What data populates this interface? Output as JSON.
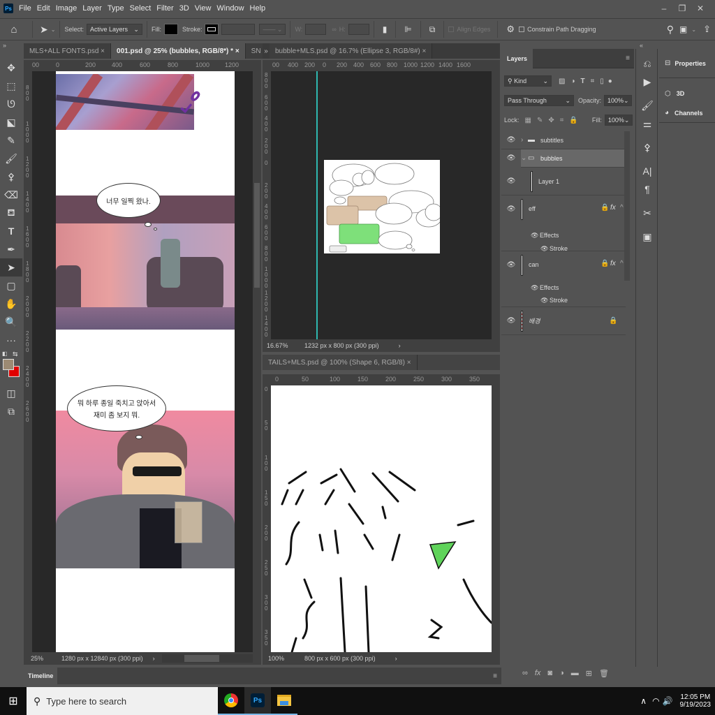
{
  "app": {
    "logo": "Ps",
    "menu": [
      "File",
      "Edit",
      "Image",
      "Layer",
      "Type",
      "Select",
      "Filter",
      "3D",
      "View",
      "Window",
      "Help"
    ]
  },
  "window_controls": {
    "minimize": "‒",
    "restore": "❐",
    "close": "✕"
  },
  "options_bar": {
    "select_label": "Select:",
    "select_value": "Active Layers",
    "fill_label": "Fill:",
    "fill_color": "#000000",
    "stroke_label": "Stroke:",
    "w_label": "W:",
    "h_label": "H:",
    "link_icon": "∞",
    "align_edges": "Align Edges",
    "constrain": "Constrain Path Dragging"
  },
  "doc1": {
    "tabs": [
      "MLS+ALL FONTS.psd",
      "001.psd @ 25% (bubbles, RGB/8*) *",
      "SN"
    ],
    "hruler": [
      "00",
      "0",
      "200",
      "400",
      "600",
      "800",
      "1000",
      "1200"
    ],
    "vruler": [
      "800",
      "1000",
      "1200",
      "1400",
      "1600",
      "1800",
      "2000",
      "2200",
      "2400",
      "2600"
    ],
    "bubble1": "너무 일찍 왔나.",
    "bubble2_line1": "뭐 하루 종일 죽치고 앉아서",
    "bubble2_line2": "재미 좀 보지 뭐.",
    "sfx": "ᄂᄋ",
    "zoom": "25%",
    "size": "1280 px x 12840 px (300 ppi)"
  },
  "doc2": {
    "tab": "bubble+MLS.psd @ 16.7% (Ellipse 3, RGB/8#)",
    "hruler": [
      "00",
      "400",
      "200",
      "0",
      "200",
      "400",
      "600",
      "800",
      "1000",
      "1200",
      "1400",
      "1600"
    ],
    "vruler": [
      "800",
      "600",
      "400",
      "200",
      "0",
      "200",
      "400",
      "600",
      "800",
      "1000",
      "1200",
      "1400"
    ],
    "zoom": "16.67%",
    "size": "1232 px x 800 px (300 ppi)"
  },
  "doc3": {
    "tab": "TAILS+MLS.psd @ 100% (Shape 6, RGB/8)",
    "hruler": [
      "0",
      "50",
      "100",
      "150",
      "200",
      "250",
      "300",
      "350"
    ],
    "vruler": [
      "0",
      "50",
      "100",
      "150",
      "200",
      "250",
      "300",
      "350"
    ],
    "zoom": "100%",
    "size": "800 px x 600 px (300 ppi)"
  },
  "timeline": {
    "label": "Timeline"
  },
  "layers": {
    "tab": "Layers",
    "kind": "Kind",
    "blend": "Pass Through",
    "opacity_label": "Opacity:",
    "opacity": "100%",
    "lock_label": "Lock:",
    "fill_label": "Fill:",
    "fill": "100%",
    "items": [
      {
        "name": "subtitles",
        "type": "group",
        "expanded": false
      },
      {
        "name": "bubbles",
        "type": "group",
        "expanded": true,
        "selected": true
      },
      {
        "name": "Layer 1",
        "type": "layer"
      },
      {
        "name": "eff",
        "type": "layer",
        "locked": true,
        "fx": true,
        "effects": "Effects",
        "stroke": "Stroke"
      },
      {
        "name": "can",
        "type": "layer",
        "locked": true,
        "fx": true,
        "effects": "Effects",
        "stroke": "Stroke"
      },
      {
        "name": "배경",
        "type": "background",
        "locked": true
      }
    ]
  },
  "right_panel": {
    "properties": "Properties",
    "three_d": "3D",
    "channels": "Channels"
  },
  "colors": {
    "foreground": "#9c8a73",
    "background": "#e00000",
    "bubble_tan": "#dcc3a8",
    "bubble_green": "#7ee07a",
    "guide": "#2fb8b0"
  },
  "taskbar": {
    "search_placeholder": "Type here to search",
    "time": "12:05 PM",
    "date": "9/19/2023"
  }
}
